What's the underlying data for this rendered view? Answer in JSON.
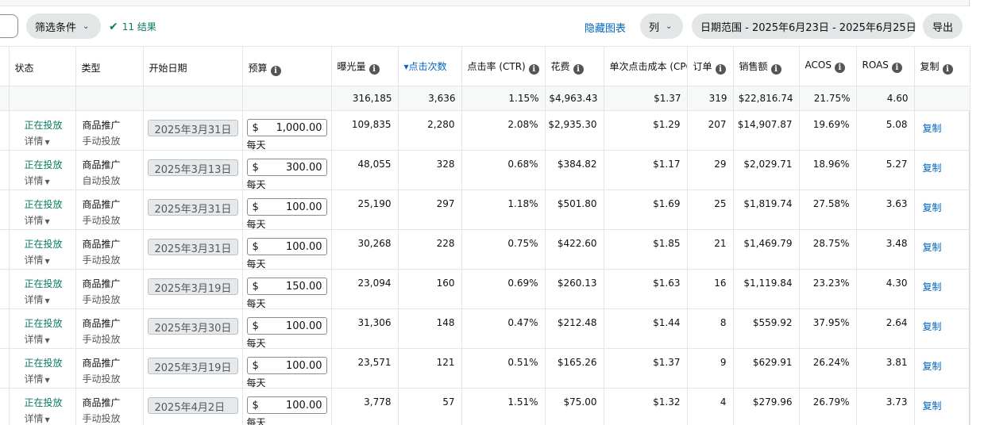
{
  "toolbar": {
    "filter_label": "筛选条件",
    "results_label": "11 结果",
    "hide_chart_label": "隐藏图表",
    "columns_label": "列",
    "date_range_label": "日期范围 - 2025年6月23日 - 2025年6月25日",
    "export_label": "导出"
  },
  "headers": {
    "status": "状态",
    "type": "类型",
    "start_date": "开始日期",
    "budget": "预算",
    "impressions": "曝光量",
    "clicks": "▾点击次数",
    "ctr": "点击率 (CTR)",
    "spend": "花费",
    "cpc": "单次点击成本 (CPC)",
    "orders": "订单",
    "sales": "销售额",
    "acos": "ACOS",
    "roas": "ROAS",
    "copy": "复制"
  },
  "totals": {
    "impressions": "316,185",
    "clicks": "3,636",
    "ctr": "1.15%",
    "spend": "$4,963.43",
    "cpc": "$1.37",
    "orders": "319",
    "sales": "$22,816.74",
    "acos": "21.75%",
    "roas": "4.60"
  },
  "rows": [
    {
      "status": "正在投放",
      "details": "详情",
      "type": "商品推广",
      "targeting": "手动投放",
      "start_date": "2025年3月31日",
      "currency": "$",
      "budget": "1,000.00",
      "period": "每天",
      "impressions": "109,835",
      "clicks": "2,280",
      "ctr": "2.08%",
      "spend": "$2,935.30",
      "cpc": "$1.29",
      "orders": "207",
      "sales": "$14,907.87",
      "acos": "19.69%",
      "roas": "5.08",
      "copy": "复制"
    },
    {
      "status": "正在投放",
      "details": "详情",
      "type": "商品推广",
      "targeting": "自动投放",
      "start_date": "2025年3月13日",
      "currency": "$",
      "budget": "300.00",
      "period": "每天",
      "impressions": "48,055",
      "clicks": "328",
      "ctr": "0.68%",
      "spend": "$384.82",
      "cpc": "$1.17",
      "orders": "29",
      "sales": "$2,029.71",
      "acos": "18.96%",
      "roas": "5.27",
      "copy": "复制"
    },
    {
      "status": "正在投放",
      "details": "详情",
      "type": "商品推广",
      "targeting": "手动投放",
      "start_date": "2025年3月31日",
      "currency": "$",
      "budget": "100.00",
      "period": "每天",
      "impressions": "25,190",
      "clicks": "297",
      "ctr": "1.18%",
      "spend": "$501.80",
      "cpc": "$1.69",
      "orders": "25",
      "sales": "$1,819.74",
      "acos": "27.58%",
      "roas": "3.63",
      "copy": "复制"
    },
    {
      "status": "正在投放",
      "details": "详情",
      "type": "商品推广",
      "targeting": "手动投放",
      "start_date": "2025年3月31日",
      "currency": "$",
      "budget": "100.00",
      "period": "每天",
      "impressions": "30,268",
      "clicks": "228",
      "ctr": "0.75%",
      "spend": "$422.60",
      "cpc": "$1.85",
      "orders": "21",
      "sales": "$1,469.79",
      "acos": "28.75%",
      "roas": "3.48",
      "copy": "复制"
    },
    {
      "status": "正在投放",
      "details": "详情",
      "type": "商品推广",
      "targeting": "手动投放",
      "start_date": "2025年3月19日",
      "currency": "$",
      "budget": "150.00",
      "period": "每天",
      "impressions": "23,094",
      "clicks": "160",
      "ctr": "0.69%",
      "spend": "$260.13",
      "cpc": "$1.63",
      "orders": "16",
      "sales": "$1,119.84",
      "acos": "23.23%",
      "roas": "4.30",
      "copy": "复制"
    },
    {
      "status": "正在投放",
      "details": "详情",
      "type": "商品推广",
      "targeting": "手动投放",
      "start_date": "2025年3月30日",
      "currency": "$",
      "budget": "100.00",
      "period": "每天",
      "impressions": "31,306",
      "clicks": "148",
      "ctr": "0.47%",
      "spend": "$212.48",
      "cpc": "$1.44",
      "orders": "8",
      "sales": "$559.92",
      "acos": "37.95%",
      "roas": "2.64",
      "copy": "复制"
    },
    {
      "status": "正在投放",
      "details": "详情",
      "type": "商品推广",
      "targeting": "手动投放",
      "start_date": "2025年3月19日",
      "currency": "$",
      "budget": "100.00",
      "period": "每天",
      "impressions": "23,571",
      "clicks": "121",
      "ctr": "0.51%",
      "spend": "$165.26",
      "cpc": "$1.37",
      "orders": "9",
      "sales": "$629.91",
      "acos": "26.24%",
      "roas": "3.81",
      "copy": "复制"
    },
    {
      "status": "正在投放",
      "details": "详情",
      "type": "商品推广",
      "targeting": "手动投放",
      "start_date": "2025年4月2日",
      "currency": "$",
      "budget": "100.00",
      "period": "每天",
      "impressions": "3,778",
      "clicks": "57",
      "ctr": "1.51%",
      "spend": "$75.00",
      "cpc": "$1.32",
      "orders": "4",
      "sales": "$279.96",
      "acos": "26.79%",
      "roas": "3.73",
      "copy": "复制"
    }
  ]
}
